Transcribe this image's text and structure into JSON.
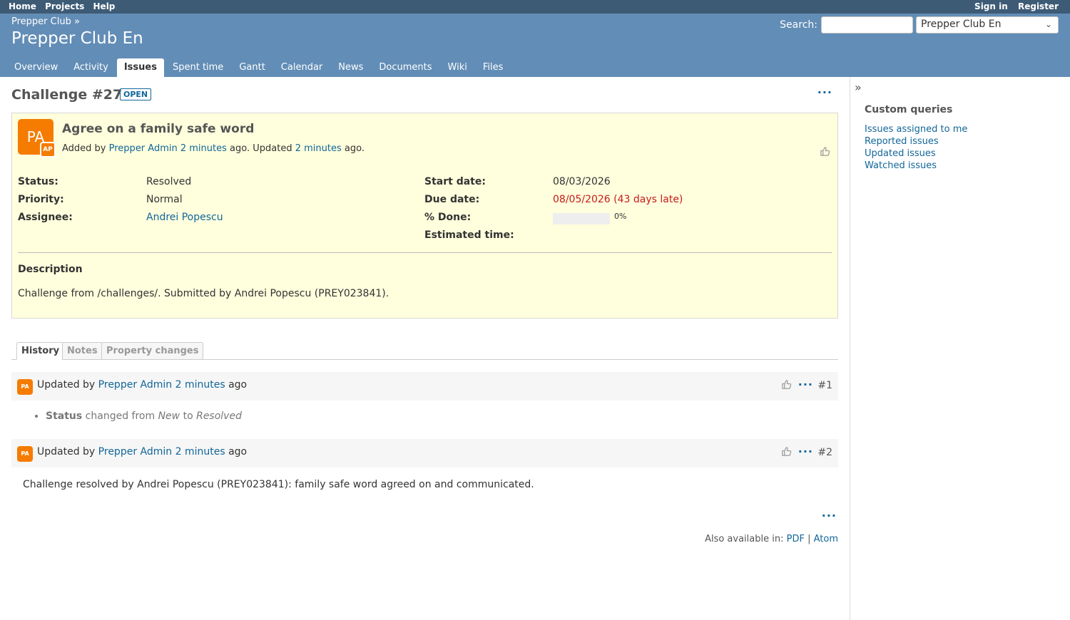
{
  "top_menu": {
    "left": [
      "Home",
      "Projects",
      "Help"
    ],
    "sign_in": "Sign in",
    "register": "Register"
  },
  "header": {
    "parent_project": "Prepper Club »",
    "title": "Prepper Club En",
    "search_label": "Search:",
    "search_value": "",
    "project_select": "Prepper Club En"
  },
  "main_menu": {
    "tabs": [
      "Overview",
      "Activity",
      "Issues",
      "Spent time",
      "Gantt",
      "Calendar",
      "News",
      "Documents",
      "Wiki",
      "Files"
    ],
    "selected": "Issues"
  },
  "issue": {
    "title": "Challenge #27",
    "status_badge": "OPEN",
    "avatar_big": "PA",
    "avatar_small": "AP",
    "subject": "Agree on a family safe word",
    "added_by": "Added by",
    "author": "Prepper Admin",
    "created": "2 minutes",
    "ago_updated": "ago. Updated",
    "updated": "2 minutes",
    "ago_end": "ago.",
    "attributes": {
      "status_label": "Status:",
      "status": "Resolved",
      "priority_label": "Priority:",
      "priority": "Normal",
      "assignee_label": "Assignee:",
      "assignee": "Andrei Popescu",
      "start_label": "Start date:",
      "start": "08/03/2026",
      "due_label": "Due date:",
      "due": "08/05/2026 (43 days late)",
      "done_label": "% Done:",
      "done": "0%",
      "done_fraction": 0,
      "estimated_label": "Estimated time:"
    },
    "description_title": "Description",
    "description": "Challenge from /challenges/. Submitted by Andrei Popescu (PREY023841)."
  },
  "history_tabs": [
    "History",
    "Notes",
    "Property changes"
  ],
  "journals": [
    {
      "avatar": "PA",
      "updated_by": "Updated by",
      "author": "Prepper Admin",
      "time": "2 minutes",
      "ago": "ago",
      "number": "#1",
      "detail_field": "Status",
      "detail_changed": "changed from",
      "detail_old": "New",
      "detail_to": "to",
      "detail_new": "Resolved"
    },
    {
      "avatar": "PA",
      "updated_by": "Updated by",
      "author": "Prepper Admin",
      "time": "2 minutes",
      "ago": "ago",
      "number": "#2",
      "note": "Challenge resolved by Andrei Popescu (PREY023841): family safe word agreed on and communicated."
    }
  ],
  "other_formats": {
    "label": "Also available in:",
    "pdf": "PDF",
    "sep": "|",
    "atom": "Atom"
  },
  "sidebar": {
    "title": "Custom queries",
    "links": [
      "Issues assigned to me",
      "Reported issues",
      "Updated issues",
      "Watched issues"
    ]
  },
  "icons": {
    "like": "thumbs-up-icon",
    "more": "ellipsis-icon",
    "sidebar_toggle": "double-chevron-right-icon"
  }
}
